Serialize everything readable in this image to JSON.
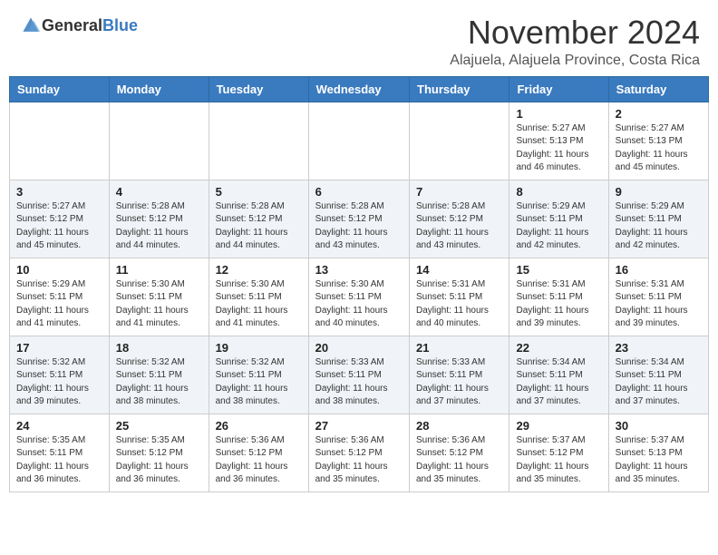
{
  "header": {
    "logo_general": "General",
    "logo_blue": "Blue",
    "month_title": "November 2024",
    "location": "Alajuela, Alajuela Province, Costa Rica"
  },
  "days_of_week": [
    "Sunday",
    "Monday",
    "Tuesday",
    "Wednesday",
    "Thursday",
    "Friday",
    "Saturday"
  ],
  "weeks": [
    [
      {
        "day": "",
        "info": ""
      },
      {
        "day": "",
        "info": ""
      },
      {
        "day": "",
        "info": ""
      },
      {
        "day": "",
        "info": ""
      },
      {
        "day": "",
        "info": ""
      },
      {
        "day": "1",
        "info": "Sunrise: 5:27 AM\nSunset: 5:13 PM\nDaylight: 11 hours and 46 minutes."
      },
      {
        "day": "2",
        "info": "Sunrise: 5:27 AM\nSunset: 5:13 PM\nDaylight: 11 hours and 45 minutes."
      }
    ],
    [
      {
        "day": "3",
        "info": "Sunrise: 5:27 AM\nSunset: 5:12 PM\nDaylight: 11 hours and 45 minutes."
      },
      {
        "day": "4",
        "info": "Sunrise: 5:28 AM\nSunset: 5:12 PM\nDaylight: 11 hours and 44 minutes."
      },
      {
        "day": "5",
        "info": "Sunrise: 5:28 AM\nSunset: 5:12 PM\nDaylight: 11 hours and 44 minutes."
      },
      {
        "day": "6",
        "info": "Sunrise: 5:28 AM\nSunset: 5:12 PM\nDaylight: 11 hours and 43 minutes."
      },
      {
        "day": "7",
        "info": "Sunrise: 5:28 AM\nSunset: 5:12 PM\nDaylight: 11 hours and 43 minutes."
      },
      {
        "day": "8",
        "info": "Sunrise: 5:29 AM\nSunset: 5:11 PM\nDaylight: 11 hours and 42 minutes."
      },
      {
        "day": "9",
        "info": "Sunrise: 5:29 AM\nSunset: 5:11 PM\nDaylight: 11 hours and 42 minutes."
      }
    ],
    [
      {
        "day": "10",
        "info": "Sunrise: 5:29 AM\nSunset: 5:11 PM\nDaylight: 11 hours and 41 minutes."
      },
      {
        "day": "11",
        "info": "Sunrise: 5:30 AM\nSunset: 5:11 PM\nDaylight: 11 hours and 41 minutes."
      },
      {
        "day": "12",
        "info": "Sunrise: 5:30 AM\nSunset: 5:11 PM\nDaylight: 11 hours and 41 minutes."
      },
      {
        "day": "13",
        "info": "Sunrise: 5:30 AM\nSunset: 5:11 PM\nDaylight: 11 hours and 40 minutes."
      },
      {
        "day": "14",
        "info": "Sunrise: 5:31 AM\nSunset: 5:11 PM\nDaylight: 11 hours and 40 minutes."
      },
      {
        "day": "15",
        "info": "Sunrise: 5:31 AM\nSunset: 5:11 PM\nDaylight: 11 hours and 39 minutes."
      },
      {
        "day": "16",
        "info": "Sunrise: 5:31 AM\nSunset: 5:11 PM\nDaylight: 11 hours and 39 minutes."
      }
    ],
    [
      {
        "day": "17",
        "info": "Sunrise: 5:32 AM\nSunset: 5:11 PM\nDaylight: 11 hours and 39 minutes."
      },
      {
        "day": "18",
        "info": "Sunrise: 5:32 AM\nSunset: 5:11 PM\nDaylight: 11 hours and 38 minutes."
      },
      {
        "day": "19",
        "info": "Sunrise: 5:32 AM\nSunset: 5:11 PM\nDaylight: 11 hours and 38 minutes."
      },
      {
        "day": "20",
        "info": "Sunrise: 5:33 AM\nSunset: 5:11 PM\nDaylight: 11 hours and 38 minutes."
      },
      {
        "day": "21",
        "info": "Sunrise: 5:33 AM\nSunset: 5:11 PM\nDaylight: 11 hours and 37 minutes."
      },
      {
        "day": "22",
        "info": "Sunrise: 5:34 AM\nSunset: 5:11 PM\nDaylight: 11 hours and 37 minutes."
      },
      {
        "day": "23",
        "info": "Sunrise: 5:34 AM\nSunset: 5:11 PM\nDaylight: 11 hours and 37 minutes."
      }
    ],
    [
      {
        "day": "24",
        "info": "Sunrise: 5:35 AM\nSunset: 5:11 PM\nDaylight: 11 hours and 36 minutes."
      },
      {
        "day": "25",
        "info": "Sunrise: 5:35 AM\nSunset: 5:12 PM\nDaylight: 11 hours and 36 minutes."
      },
      {
        "day": "26",
        "info": "Sunrise: 5:36 AM\nSunset: 5:12 PM\nDaylight: 11 hours and 36 minutes."
      },
      {
        "day": "27",
        "info": "Sunrise: 5:36 AM\nSunset: 5:12 PM\nDaylight: 11 hours and 35 minutes."
      },
      {
        "day": "28",
        "info": "Sunrise: 5:36 AM\nSunset: 5:12 PM\nDaylight: 11 hours and 35 minutes."
      },
      {
        "day": "29",
        "info": "Sunrise: 5:37 AM\nSunset: 5:12 PM\nDaylight: 11 hours and 35 minutes."
      },
      {
        "day": "30",
        "info": "Sunrise: 5:37 AM\nSunset: 5:13 PM\nDaylight: 11 hours and 35 minutes."
      }
    ]
  ]
}
